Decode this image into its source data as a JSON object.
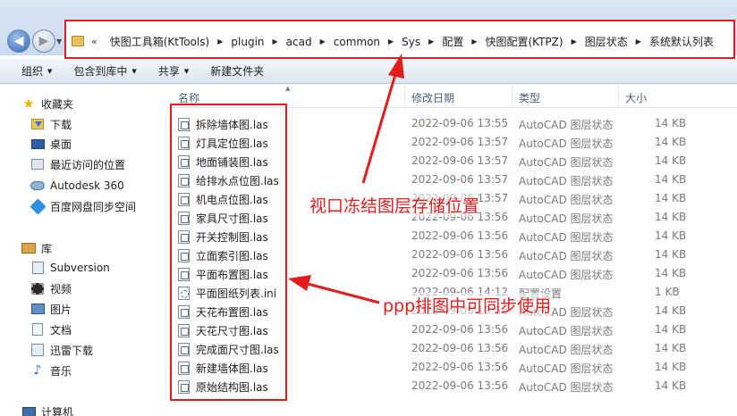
{
  "address": {
    "chevron": "«",
    "crumbs": [
      "快图工具箱(KtTools)",
      "plugin",
      "acad",
      "common",
      "Sys",
      "配置",
      "快图配置(KTPZ)",
      "图层状态",
      "系统默认列表"
    ]
  },
  "toolbar": {
    "organize": "组织",
    "include_in_library": "包含到库中",
    "share": "共享",
    "new_folder": "新建文件夹"
  },
  "nav": {
    "favorites": "收藏夹",
    "favorites_items": [
      "下载",
      "桌面",
      "最近访问的位置",
      "Autodesk 360",
      "百度网盘同步空间"
    ],
    "libraries": "库",
    "library_items": [
      "Subversion",
      "视频",
      "图片",
      "文档",
      "迅雷下载",
      "音乐"
    ],
    "computer": "计算机"
  },
  "columns": {
    "name": "名称",
    "date": "修改日期",
    "type": "类型",
    "size": "大小"
  },
  "files": [
    {
      "name": "拆除墙体图.las",
      "date": "2022-09-06 13:55",
      "type": "AutoCAD 图层状态",
      "size": "14 KB"
    },
    {
      "name": "灯具定位图.las",
      "date": "2022-09-06 13:57",
      "type": "AutoCAD 图层状态",
      "size": "14 KB"
    },
    {
      "name": "地面铺装图.las",
      "date": "2022-09-06 13:57",
      "type": "AutoCAD 图层状态",
      "size": "14 KB"
    },
    {
      "name": "给排水点位图.las",
      "date": "2022-09-06 13:57",
      "type": "AutoCAD 图层状态",
      "size": "14 KB"
    },
    {
      "name": "机电点位图.las",
      "date": "2022-09-06 13:57",
      "type": "AutoCAD 图层状态",
      "size": "14 KB"
    },
    {
      "name": "家具尺寸图.las",
      "date": "2022-09-06 13:56",
      "type": "AutoCAD 图层状态",
      "size": "14 KB"
    },
    {
      "name": "开关控制图.las",
      "date": "2022-09-06 13:56",
      "type": "AutoCAD 图层状态",
      "size": "14 KB"
    },
    {
      "name": "立面索引图.las",
      "date": "2022-09-06 13:56",
      "type": "AutoCAD 图层状态",
      "size": "14 KB"
    },
    {
      "name": "平面布置图.las",
      "date": "2022-09-06 13:56",
      "type": "AutoCAD 图层状态",
      "size": "14 KB"
    },
    {
      "name": "平面图纸列表.ini",
      "date": "2022-09-06 14:12",
      "type": "配置设置",
      "size": "1 KB"
    },
    {
      "name": "天花布置图.las",
      "date": "2022-09-06 13:56",
      "type": "AutoCAD 图层状态",
      "size": "14 KB"
    },
    {
      "name": "天花尺寸图.las",
      "date": "2022-09-06 13:56",
      "type": "AutoCAD 图层状态",
      "size": "14 KB"
    },
    {
      "name": "完成面尺寸图.las",
      "date": "2022-09-06 13:56",
      "type": "AutoCAD 图层状态",
      "size": "14 KB"
    },
    {
      "name": "新建墙体图.las",
      "date": "2022-09-06 13:56",
      "type": "AutoCAD 图层状态",
      "size": "14 KB"
    },
    {
      "name": "原始结构图.las",
      "date": "2022-09-06 13:56",
      "type": "AutoCAD 图层状态",
      "size": "14 KB"
    }
  ],
  "annotations": {
    "viewport_freeze_label": "视口冻结图层存储位置",
    "ppp_sync_label": "ppp排图中可同步使用"
  },
  "colors": {
    "annotation_red": "#e51c1c",
    "header_text": "#4c607a",
    "meta_text": "#7a7a7a"
  }
}
